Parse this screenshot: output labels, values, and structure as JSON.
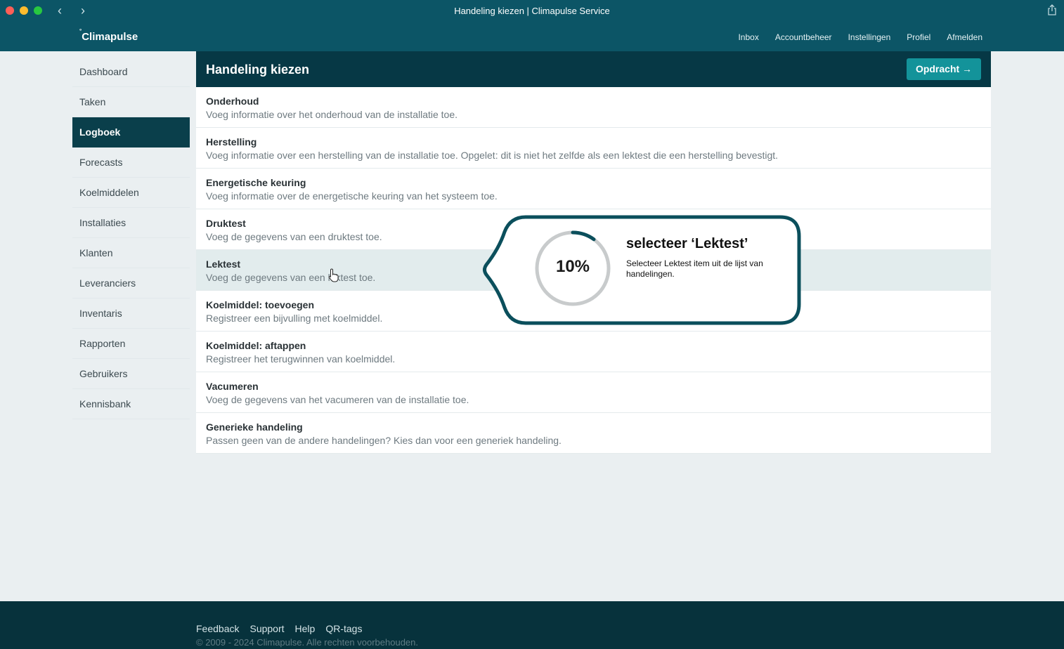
{
  "window": {
    "title": "Handeling kiezen | Climapulse Service"
  },
  "app": {
    "logo_mark": "°",
    "logo_text": "Climapulse",
    "topnav": [
      "Inbox",
      "Accountbeheer",
      "Instellingen",
      "Profiel",
      "Afmelden"
    ]
  },
  "sidebar": {
    "items": [
      {
        "label": "Dashboard"
      },
      {
        "label": "Taken"
      },
      {
        "label": "Logboek"
      },
      {
        "label": "Forecasts"
      },
      {
        "label": "Koelmiddelen"
      },
      {
        "label": "Installaties"
      },
      {
        "label": "Klanten"
      },
      {
        "label": "Leveranciers"
      },
      {
        "label": "Inventaris"
      },
      {
        "label": "Rapporten"
      },
      {
        "label": "Gebruikers"
      },
      {
        "label": "Kennisbank"
      }
    ],
    "active": "Logboek"
  },
  "panel": {
    "title": "Handeling kiezen",
    "button_label": "Opdracht →"
  },
  "actions": [
    {
      "title": "Onderhoud",
      "desc": "Voeg informatie over het onderhoud van de installatie toe."
    },
    {
      "title": "Herstelling",
      "desc": "Voeg informatie over een herstelling van de installatie toe. Opgelet: dit is niet het zelfde als een lektest die een herstelling bevestigt."
    },
    {
      "title": "Energetische keuring",
      "desc": "Voeg informatie over de energetische keuring van het systeem toe."
    },
    {
      "title": "Druktest",
      "desc": "Voeg de gegevens van een druktest toe."
    },
    {
      "title": "Lektest",
      "desc": "Voeg de gegevens van een lektest toe."
    },
    {
      "title": "Koelmiddel: toevoegen",
      "desc": "Registreer een bijvulling met koelmiddel."
    },
    {
      "title": "Koelmiddel: aftappen",
      "desc": "Registreer het terugwinnen van koelmiddel."
    },
    {
      "title": "Vacumeren",
      "desc": "Voeg de gegevens van het vacumeren van de installatie toe."
    },
    {
      "title": "Generieke handeling",
      "desc": "Passen geen van de andere handelingen? Kies dan voor een generiek handeling."
    }
  ],
  "highlighted_action": "Lektest",
  "tooltip": {
    "progress_percent": 10,
    "progress_label": "10%",
    "title": "selecteer ‘Lektest’",
    "text": "Selecteer Lektest item uit de lijst van handelingen."
  },
  "footer": {
    "links": [
      "Feedback",
      "Support",
      "Help",
      "QR-tags"
    ],
    "copyright": "© 2009 - 2024 Climapulse. Alle rechten voorbehouden."
  },
  "colors": {
    "header": "#0c5566",
    "panel_header": "#063845",
    "active_nav": "#0a3f4b",
    "accent_button": "#13939a",
    "highlight_row": "#e2eced",
    "footer": "#07323c",
    "callout_border": "#0b4f5c"
  }
}
